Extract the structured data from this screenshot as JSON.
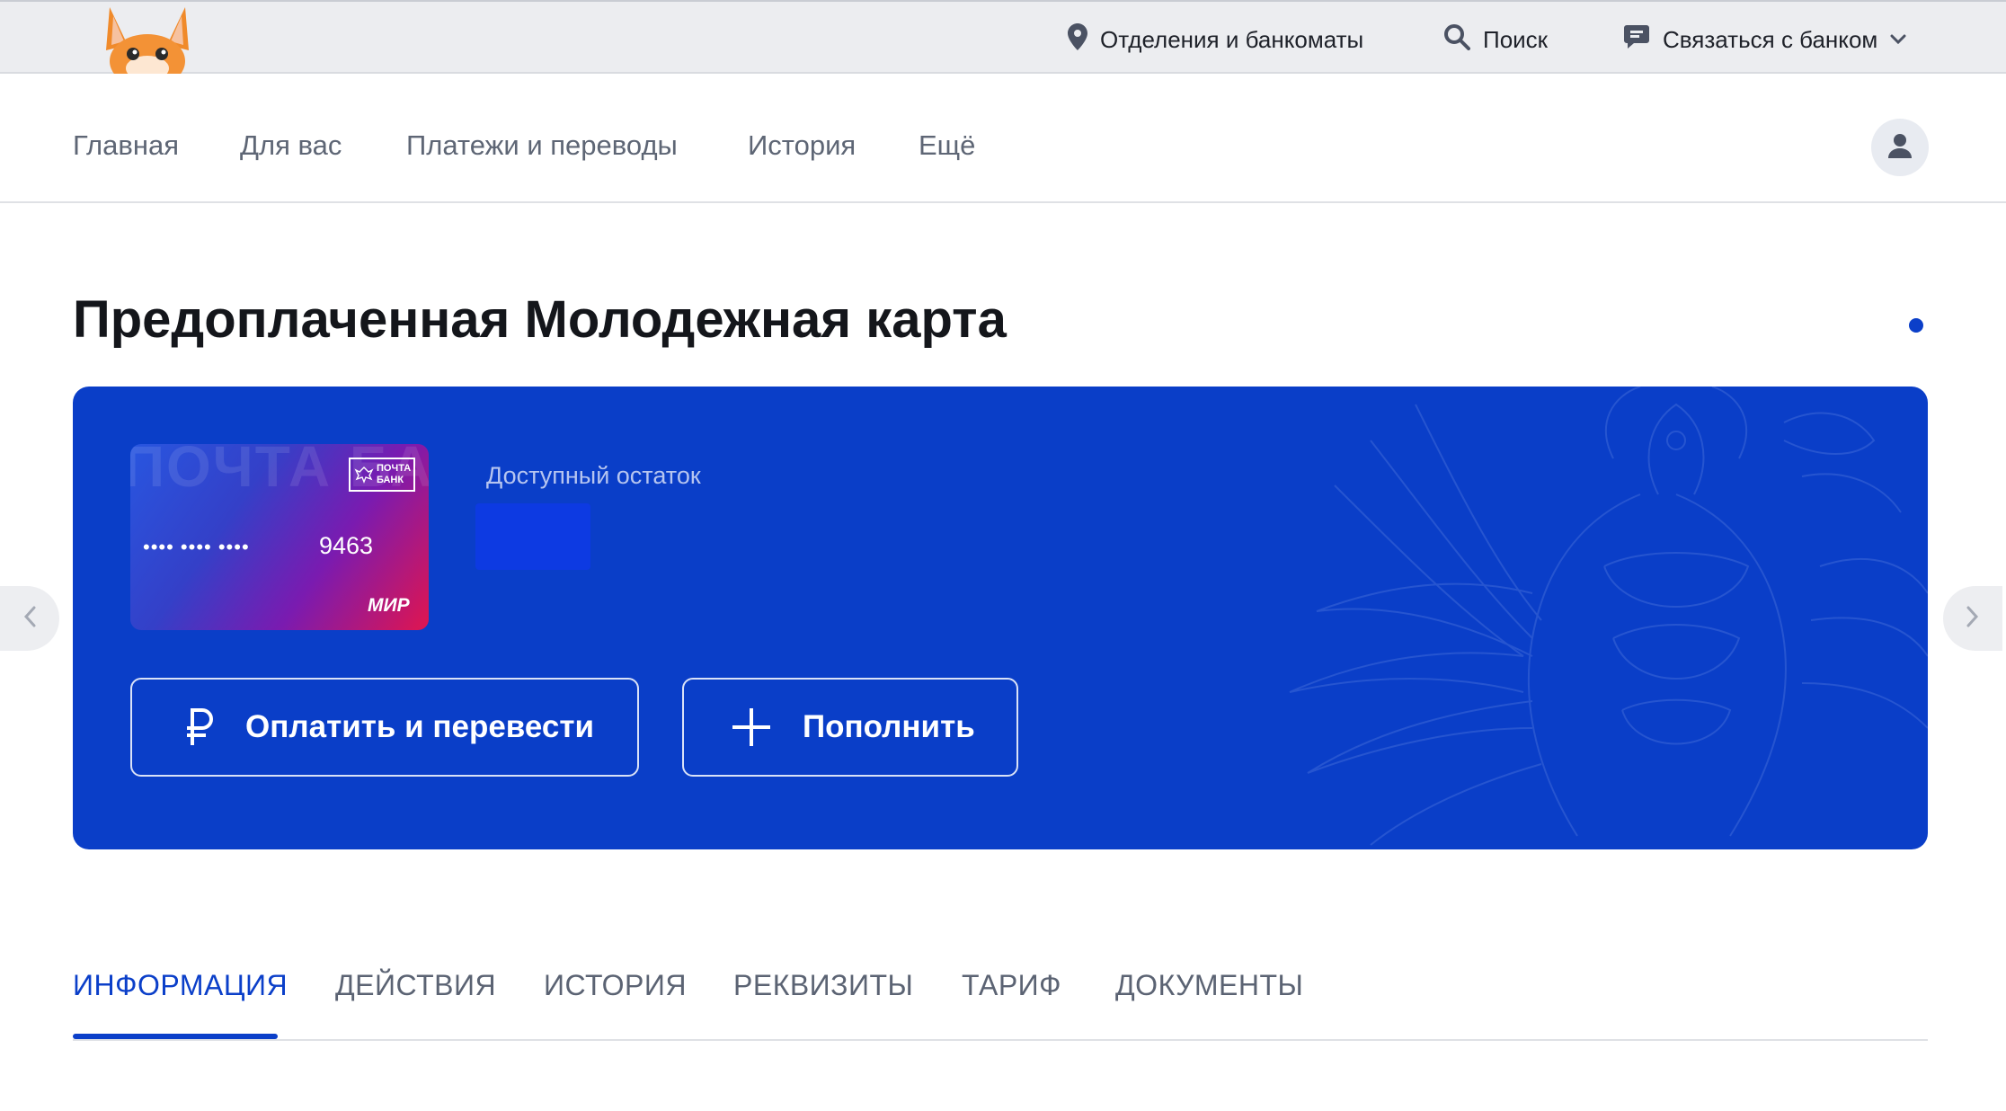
{
  "topbar": {
    "branches_label": "Отделения и банкоматы",
    "search_label": "Поиск",
    "contact_label": "Связаться с банком"
  },
  "nav": {
    "items": [
      {
        "label": "Главная"
      },
      {
        "label": "Для вас"
      },
      {
        "label": "Платежи и переводы"
      },
      {
        "label": "История"
      },
      {
        "label": "Ещё"
      }
    ]
  },
  "page": {
    "title": "Предоплаченная Молодежная карта"
  },
  "card": {
    "bg_text": "ПОЧТА БАНК",
    "logo_text_1": "ПОЧТА",
    "logo_text_2": "БАНК",
    "masked_groups": "•••• •••• ••••",
    "last4": "9463",
    "payment_system": "МИР"
  },
  "balance": {
    "label": "Доступный остаток"
  },
  "actions": {
    "pay_label": "Оплатить и перевести",
    "topup_label": "Пополнить"
  },
  "tabs": [
    {
      "label": "ИНФОРМАЦИЯ",
      "active": true
    },
    {
      "label": "ДЕЙСТВИЯ"
    },
    {
      "label": "ИСТОРИЯ"
    },
    {
      "label": "РЕКВИЗИТЫ"
    },
    {
      "label": "ТАРИФ"
    },
    {
      "label": "ДОКУМЕНТЫ"
    }
  ],
  "colors": {
    "brand_blue": "#0A3EC8",
    "accent_blue": "#0B3FC9",
    "topbar_bg": "#ECEDF0"
  },
  "icons": {
    "branches": "location-pin-icon",
    "search": "search-icon",
    "contact": "chat-icon",
    "chevron": "chevron-down-icon",
    "user": "user-icon",
    "pay": "ruble-icon",
    "topup": "plus-icon"
  }
}
